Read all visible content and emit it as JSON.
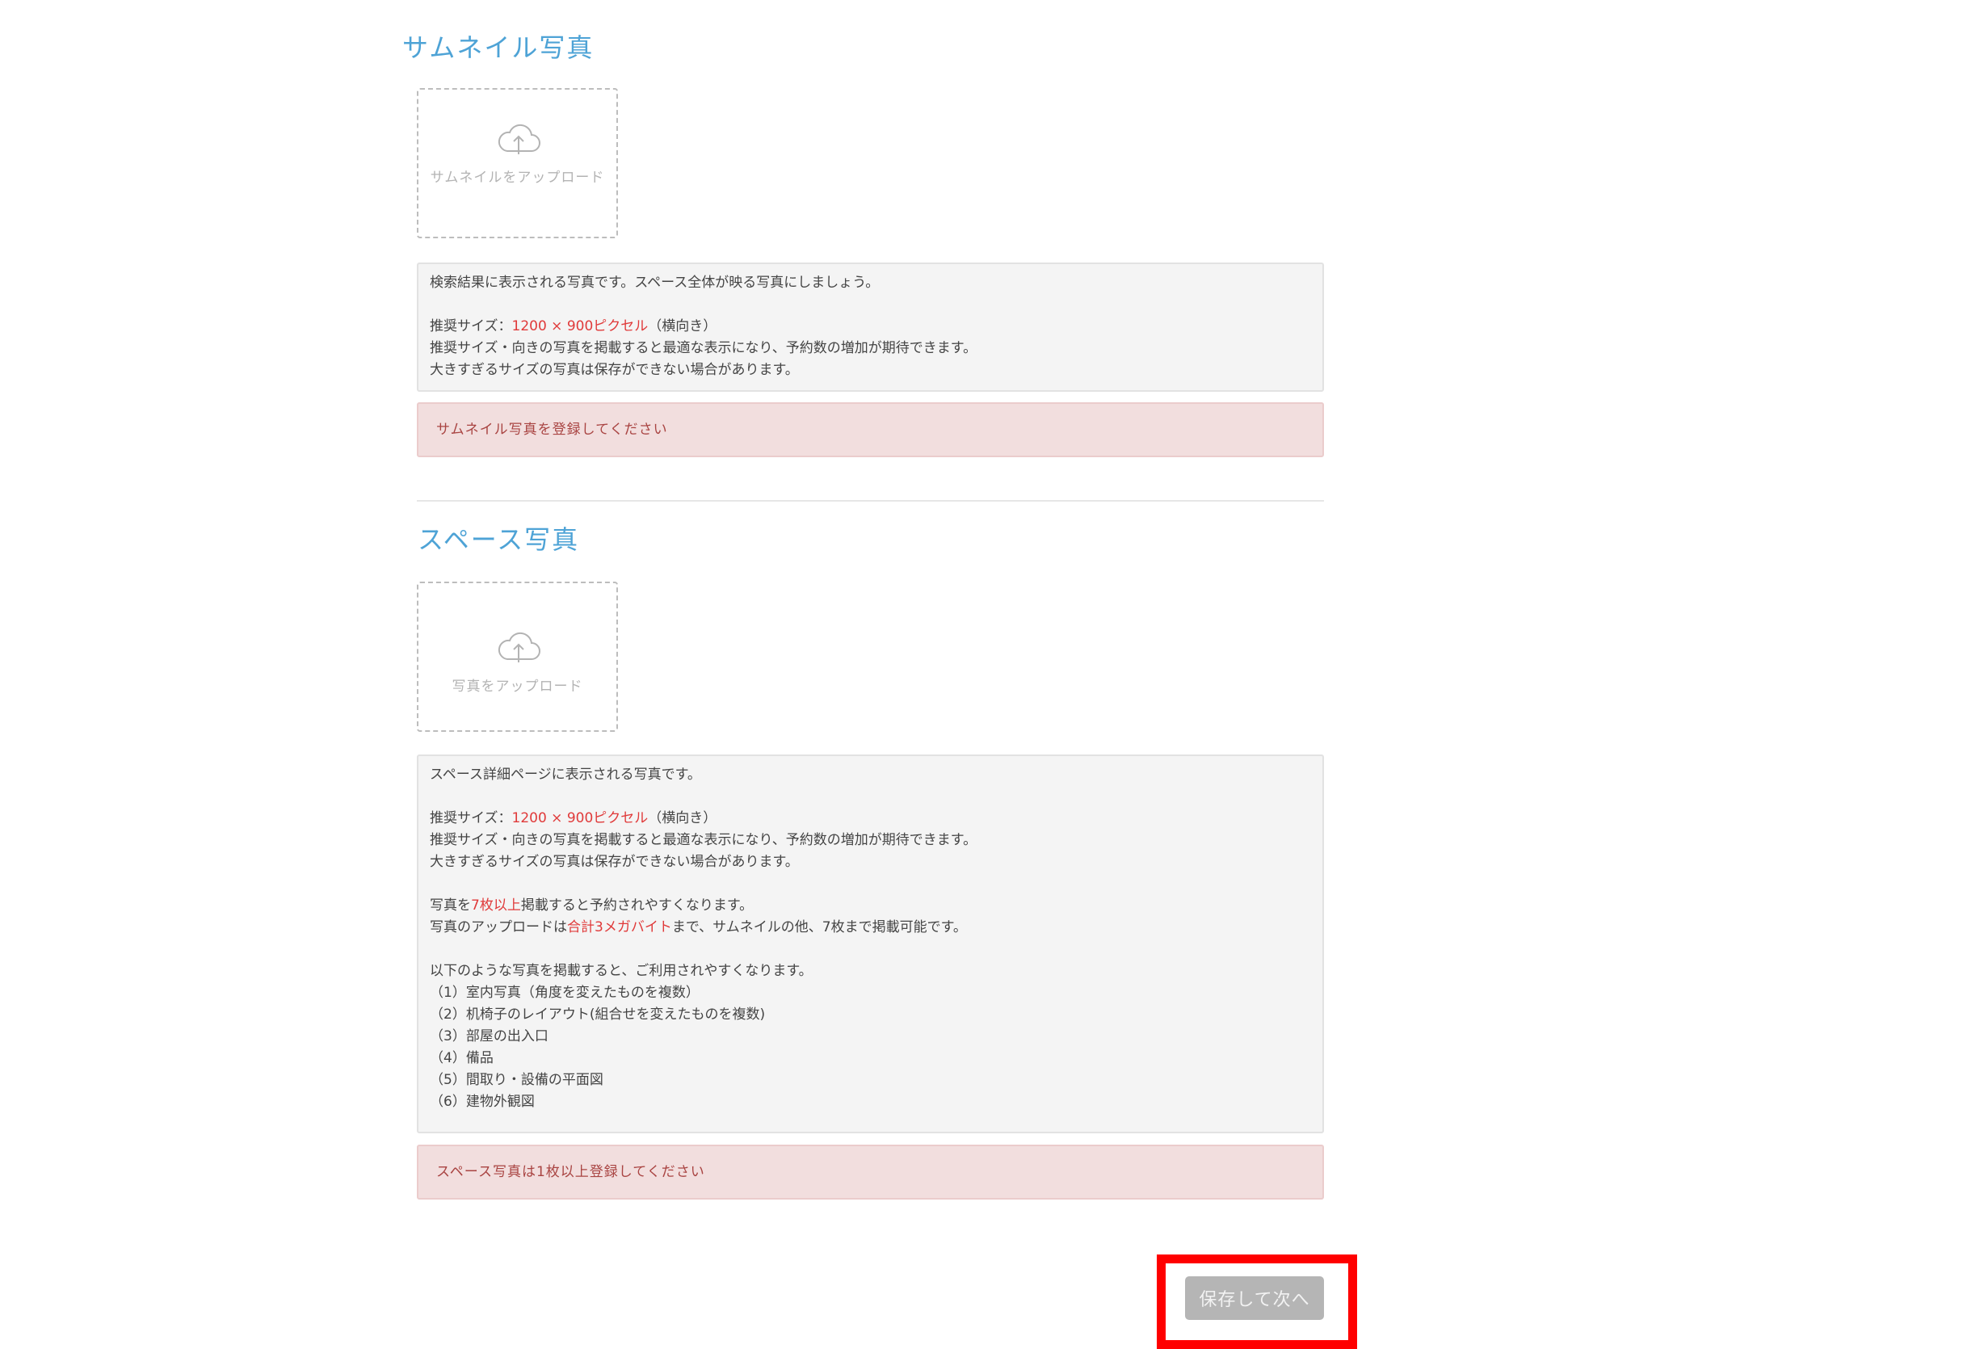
{
  "thumbnail": {
    "title": "サムネイル写真",
    "upload_label": "サムネイルをアップロード",
    "upload_icon": "cloud-upload-icon",
    "info": {
      "line1": "検索結果に表示される写真です。スペース全体が映る写真にしましょう。",
      "size_prefix": "推奨サイズ：",
      "size_value": "1200 × 900ピクセル",
      "size_suffix": "（横向き）",
      "line3": "推奨サイズ・向きの写真を掲載すると最適な表示になり、予約数の増加が期待できます。",
      "line4": "大きすぎるサイズの写真は保存ができない場合があります。"
    },
    "alert": "サムネイル写真を登録してください"
  },
  "space": {
    "title": "スペース写真",
    "upload_label": "写真をアップロード",
    "upload_icon": "cloud-upload-icon",
    "info": {
      "line1": "スペース詳細ページに表示される写真です。",
      "size_prefix": "推奨サイズ：",
      "size_value": "1200 × 900ピクセル",
      "size_suffix": "（横向き）",
      "line3": "推奨サイズ・向きの写真を掲載すると最適な表示になり、予約数の増加が期待できます。",
      "line4": "大きすぎるサイズの写真は保存ができない場合があります。",
      "count_prefix": "写真を",
      "count_value": "7枚以上",
      "count_suffix": "掲載すると予約されやすくなります。",
      "limit_prefix": "写真のアップロードは",
      "limit_value": "合計3メガバイト",
      "limit_suffix": "まで、サムネイルの他、7枚まで掲載可能です。",
      "list_intro": "以下のような写真を掲載すると、ご利用されやすくなります。",
      "list": [
        "（1）室内写真（角度を変えたものを複数）",
        "（2）机椅子のレイアウト(組合せを変えたものを複数)",
        "（3）部屋の出入口",
        "（4）備品",
        "（5）間取り・設備の平面図",
        "（6）建物外観図"
      ]
    },
    "alert": "スペース写真は1枚以上登録してください"
  },
  "actions": {
    "save_next_label": "保存して次へ"
  },
  "colors": {
    "accent": "#4ea3d6",
    "highlight": "#e03a3a",
    "alert_bg": "#f2dede",
    "alert_text": "#a94442",
    "frame": "#ff0000"
  }
}
